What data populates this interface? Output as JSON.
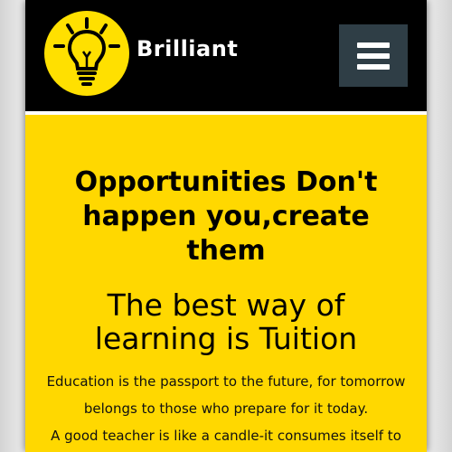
{
  "brand": {
    "name": "Brilliant",
    "logo_icon": "lightbulb-icon",
    "logo_color": "#ffe000"
  },
  "menu": {
    "icon": "hamburger-menu-icon",
    "button_color": "#2f3e46"
  },
  "hero": {
    "background": "#ffd800",
    "headline": "Opportunities Don't happen you,create them",
    "subheadline": "The best way of learning is Tuition",
    "paragraph_1": "Education is the passport to the future, for tomorrow belongs to those who prepare for it today.",
    "paragraph_2": "A good teacher is like a candle-it consumes itself to"
  }
}
